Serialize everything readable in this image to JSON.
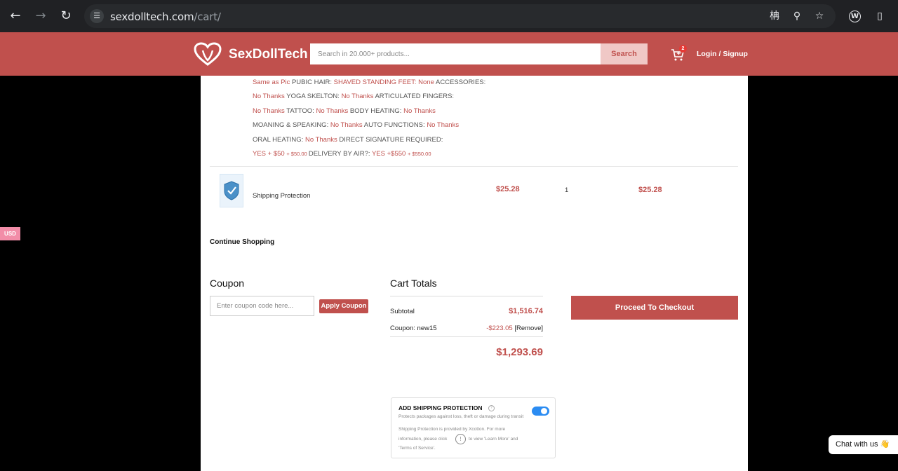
{
  "browser": {
    "url_domain": "sexdolltech.com",
    "url_path": "/cart/",
    "back_icon": "arrow-left-icon",
    "forward_icon": "arrow-right-icon",
    "reload_icon": "reload-icon"
  },
  "header": {
    "logo_text": "SexDollTech",
    "search_placeholder": "Search in 20.000+ products...",
    "search_button": "Search",
    "cart_count": "2",
    "login_label": "Login / Signup",
    "brand_color": "#c0504d"
  },
  "options_lines": [
    [
      {
        "t": "Same as Pic ",
        "v": true
      },
      {
        "t": "PUBIC HAIR: "
      },
      {
        "t": "SHAVED STANDING FEET: ",
        "v": true
      },
      {
        "t": "None ",
        "v": true
      },
      {
        "t": "ACCESSORIES:"
      }
    ],
    [
      {
        "t": "No Thanks ",
        "v": true
      },
      {
        "t": "YOGA SKELTON: "
      },
      {
        "t": "No Thanks ",
        "v": true
      },
      {
        "t": "ARTICULATED FINGERS:"
      }
    ],
    [
      {
        "t": "No Thanks ",
        "v": true
      },
      {
        "t": "TATTOO: "
      },
      {
        "t": "No Thanks ",
        "v": true
      },
      {
        "t": "BODY HEATING: "
      },
      {
        "t": "No Thanks",
        "v": true
      }
    ],
    [
      {
        "t": "MOANING & SPEAKING: "
      },
      {
        "t": "No Thanks ",
        "v": true
      },
      {
        "t": "AUTO FUNCTIONS: "
      },
      {
        "t": "No Thanks",
        "v": true
      }
    ],
    [
      {
        "t": "ORAL HEATING: "
      },
      {
        "t": "No Thanks ",
        "v": true
      },
      {
        "t": "DIRECT SIGNATURE REQUIRED:"
      }
    ],
    [
      {
        "t": "YES + $50 ",
        "v": true
      },
      {
        "t": "+ $50.00 ",
        "s": true
      },
      {
        "t": "DELIVERY BY AIR?: "
      },
      {
        "t": "YES +$550 ",
        "v": true
      },
      {
        "t": "+ $550.00",
        "s": true
      }
    ]
  ],
  "cart_item": {
    "name": "Shipping Protection",
    "price": "$25.28",
    "qty": "1",
    "total": "$25.28"
  },
  "continue_shopping": "Continue Shopping",
  "coupon": {
    "title": "Coupon",
    "placeholder": "Enter coupon code here...",
    "apply_label": "Apply Coupon"
  },
  "totals": {
    "title": "Cart Totals",
    "subtotal_label": "Subtotal",
    "subtotal_value": "$1,516.74",
    "coupon_label": "Coupon: new15",
    "coupon_discount": "-$223.05",
    "coupon_remove": "[Remove]",
    "total": "$1,293.69"
  },
  "checkout_label": "Proceed To Checkout",
  "shipping_protection": {
    "title": "ADD SHIPPING PROTECTION",
    "enabled": true,
    "desc": "Protects packages against loss, theft or damage during transit",
    "line2": "Shipping Protection is provided by Xcotton. For more",
    "line3_pre": "information, please click",
    "line3_post": "to view 'Learn More' and",
    "line4": "'Terms of Service'."
  },
  "currency_label": "USD",
  "chat_label": "Chat with us 👋"
}
